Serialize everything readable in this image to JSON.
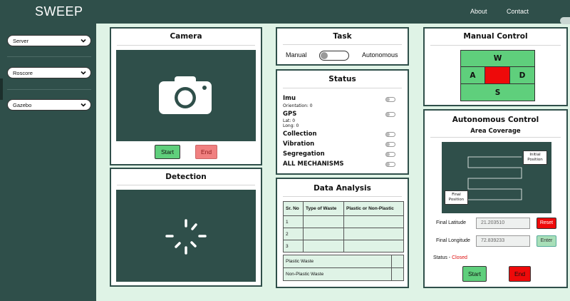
{
  "header": {
    "brand": "SWEEP",
    "nav": [
      "About",
      "Contact"
    ]
  },
  "sidebar": {
    "selects": [
      "Server",
      "Roscore",
      "Gazebo"
    ]
  },
  "camera": {
    "title": "Camera",
    "start_label": "Start",
    "end_label": "End"
  },
  "detection": {
    "title": "Detection"
  },
  "task": {
    "title": "Task",
    "manual_label": "Manual",
    "autonomous_label": "Autonomous"
  },
  "status": {
    "title": "Status",
    "imu": "Imu",
    "imu_orientation": "Orientation: 0",
    "gps": "GPS",
    "gps_lat": "Lat: 0",
    "gps_long": "Long: 0",
    "collection": "Collection",
    "vibration": "Vibration",
    "segregation": "Segregation",
    "all": "ALL MECHANISMS"
  },
  "data_analysis": {
    "title": "Data Analysis",
    "headers": [
      "Sr. No",
      "Type of Waste",
      "Plastic or Non-Plastic"
    ],
    "rows": [
      "1",
      "2",
      "3"
    ],
    "summary": [
      "Plastic Waste",
      "Non-Plastic Waste"
    ]
  },
  "manual_control": {
    "title": "Manual Control",
    "up": "W",
    "left": "A",
    "right": "D",
    "down": "S"
  },
  "autonomous_control": {
    "title": "Autonomous Control",
    "subtitle": "Area Coverage",
    "initial_label": [
      "Initial",
      "Position"
    ],
    "final_label": [
      "Final",
      "Position"
    ],
    "final_lat_label": "Final Latitude",
    "final_lat_value": "21.203510",
    "final_long_label": "Final Longitude",
    "final_long_value": "72.839233",
    "reset_label": "Reset",
    "enter_label": "Enter",
    "status_label": "Status -",
    "status_value": "Closed",
    "start_label": "Start",
    "end_label": "End"
  },
  "colors": {
    "dark": "#2f4f4a",
    "bg": "#dff3e6",
    "green": "#5fcf7c",
    "red": "#ee0a0a",
    "status_closed": "#dd1010"
  },
  "icons": [
    "chevron-down-icon",
    "camera-icon",
    "loading-spinner-icon"
  ]
}
